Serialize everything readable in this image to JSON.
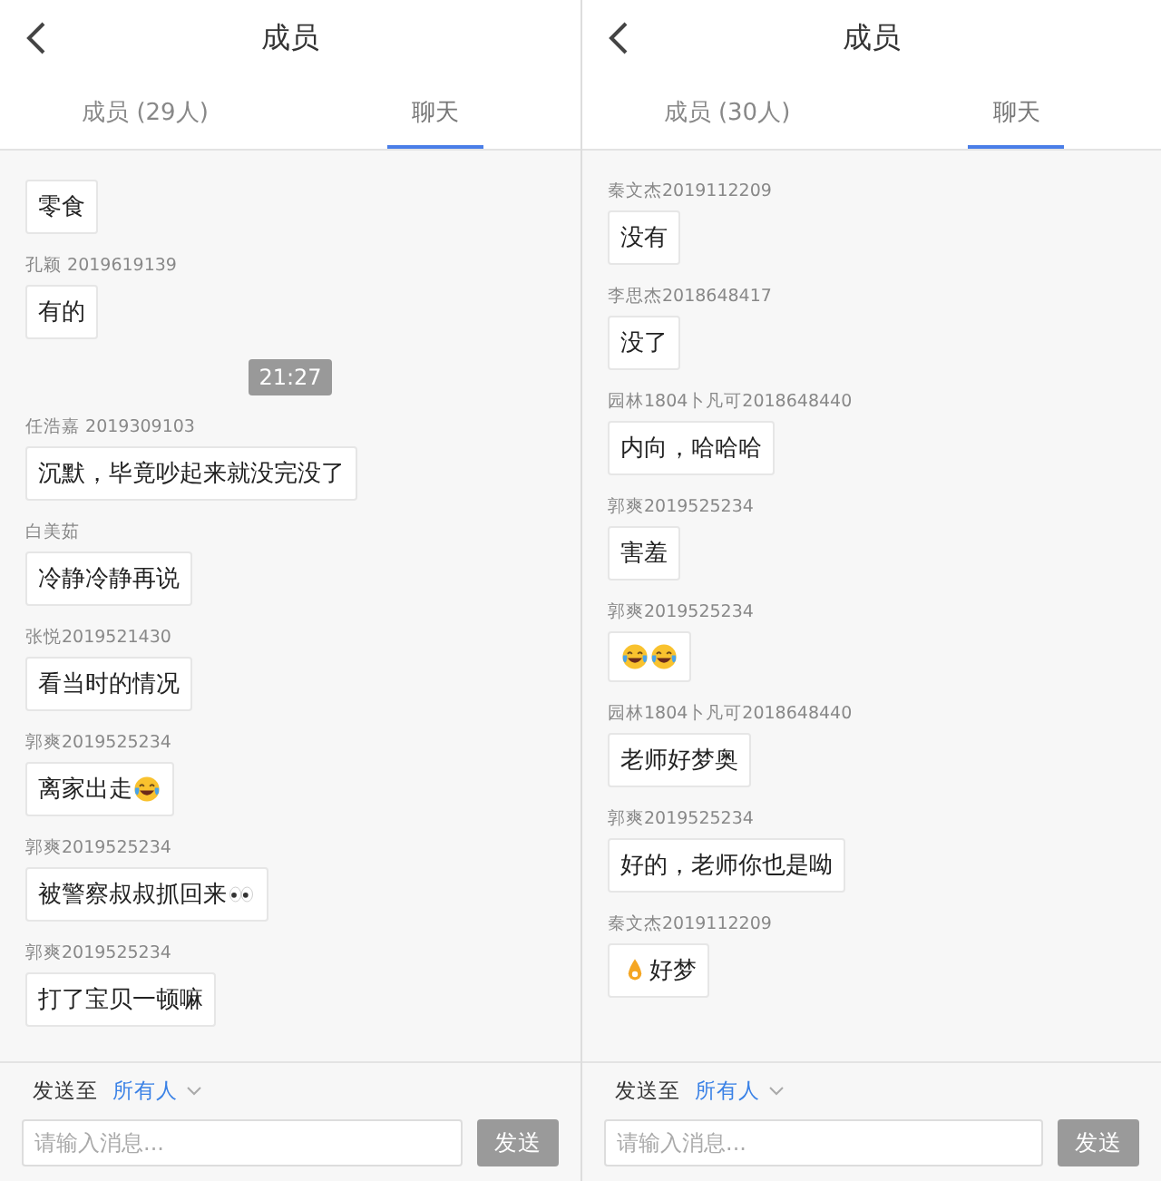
{
  "screens": [
    {
      "title": "成员",
      "tabs": [
        {
          "label": "成员 (29人)",
          "selected": false
        },
        {
          "label": "聊天",
          "selected": true
        }
      ],
      "messages": [
        {
          "kind": "message",
          "parts": [
            {
              "kind": "text",
              "text": "零食"
            }
          ]
        },
        {
          "kind": "message",
          "sender": "孔颖 2019619139",
          "parts": [
            {
              "kind": "text",
              "text": "有的"
            }
          ]
        },
        {
          "kind": "time",
          "text": "21:27"
        },
        {
          "kind": "message",
          "sender": "任浩嘉 2019309103",
          "parts": [
            {
              "kind": "text",
              "text": "沉默，毕竟吵起来就没完没了"
            }
          ]
        },
        {
          "kind": "message",
          "sender": "白美茹",
          "parts": [
            {
              "kind": "text",
              "text": "冷静冷静再说"
            }
          ]
        },
        {
          "kind": "message",
          "sender": "张悦2019521430",
          "parts": [
            {
              "kind": "text",
              "text": "看当时的情况"
            }
          ]
        },
        {
          "kind": "message",
          "sender": "郭爽2019525234",
          "parts": [
            {
              "kind": "text",
              "text": "离家出走"
            },
            {
              "kind": "laugh"
            }
          ]
        },
        {
          "kind": "message",
          "sender": "郭爽2019525234",
          "parts": [
            {
              "kind": "text",
              "text": "被警察叔叔抓回来"
            },
            {
              "kind": "eyes"
            }
          ]
        },
        {
          "kind": "message",
          "sender": "郭爽2019525234",
          "parts": [
            {
              "kind": "text",
              "text": "打了宝贝一顿嘛"
            }
          ]
        }
      ],
      "send_to_label": "发送至",
      "recipient": "所有人",
      "input": {
        "placeholder": "请输入消息..."
      },
      "send_button": {
        "label": "发送",
        "disabled": true
      }
    },
    {
      "title": "成员",
      "tabs": [
        {
          "label": "成员 (30人)",
          "selected": false
        },
        {
          "label": "聊天",
          "selected": true
        }
      ],
      "messages": [
        {
          "kind": "message",
          "sender": "秦文杰2019112209",
          "parts": [
            {
              "kind": "text",
              "text": "没有"
            }
          ]
        },
        {
          "kind": "message",
          "sender": "李思杰2018648417",
          "parts": [
            {
              "kind": "text",
              "text": "没了"
            }
          ]
        },
        {
          "kind": "message",
          "sender": "园林1804卜凡可2018648440",
          "parts": [
            {
              "kind": "text",
              "text": "内向，哈哈哈"
            }
          ]
        },
        {
          "kind": "message",
          "sender": "郭爽2019525234",
          "parts": [
            {
              "kind": "text",
              "text": "害羞"
            }
          ]
        },
        {
          "kind": "message",
          "sender": "郭爽2019525234",
          "parts": [
            {
              "kind": "laugh"
            },
            {
              "kind": "laugh"
            }
          ]
        },
        {
          "kind": "message",
          "sender": "园林1804卜凡可2018648440",
          "parts": [
            {
              "kind": "text",
              "text": "老师好梦奥"
            }
          ]
        },
        {
          "kind": "message",
          "sender": "郭爽2019525234",
          "parts": [
            {
              "kind": "text",
              "text": "好的，老师你也是呦"
            }
          ]
        },
        {
          "kind": "message",
          "sender": "秦文杰2019112209",
          "parts": [
            {
              "kind": "ok"
            },
            {
              "kind": "text",
              "text": "好梦"
            }
          ]
        }
      ],
      "send_to_label": "发送至",
      "recipient": "所有人",
      "input": {
        "placeholder": "请输入消息..."
      },
      "send_button": {
        "label": "发送",
        "disabled": true
      }
    }
  ]
}
